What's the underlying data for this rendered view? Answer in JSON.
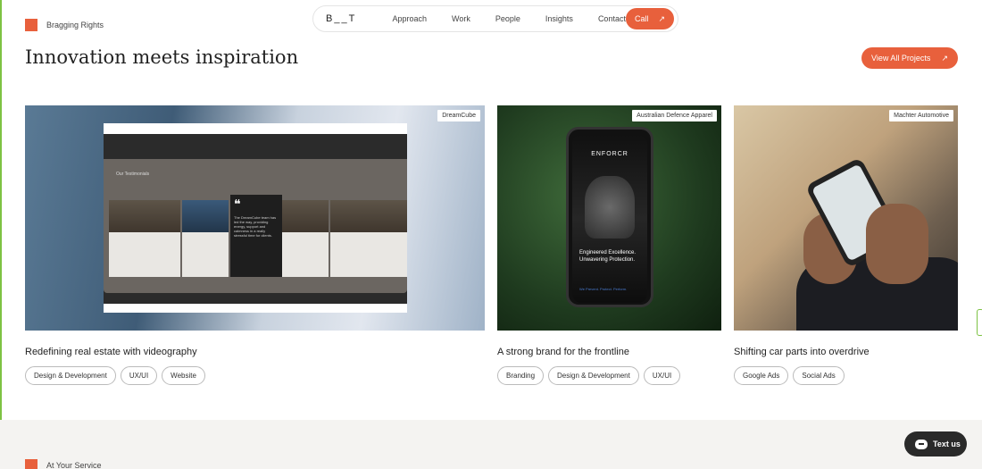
{
  "accent_color": "#e8603c",
  "nav": {
    "logo": "B__T",
    "links": [
      "Approach",
      "Work",
      "People",
      "Insights",
      "Contact"
    ],
    "call_label": "Call",
    "call_icon": "arrow-up-right-icon"
  },
  "section": {
    "tag": "Bragging Rights",
    "headline": "Innovation meets inspiration",
    "view_all_label": "View All Projects"
  },
  "projects": [
    {
      "client": "DreamCube",
      "title": "Redefining real estate with videography",
      "tags": [
        "Design & Development",
        "UX/UI",
        "Website"
      ],
      "mock_heading": "Our Testimonials",
      "mock_quote": "The DreamCube team has led the way, providing energy, support and calmness in a really stressful time for clients."
    },
    {
      "client": "Australian Defence Apparel",
      "title": "A strong brand for the frontline",
      "tags": [
        "Branding",
        "Design & Development",
        "UX/UI"
      ],
      "mock_brand": "ENFORCR",
      "mock_tagline": "Engineered Excellence. Unwavering Protection.",
      "mock_footer": "We Prevent. Protect. Perform."
    },
    {
      "client": "Machter Automotive",
      "title": "Shifting car parts into overdrive",
      "tags": [
        "Google Ads",
        "Social Ads"
      ]
    }
  ],
  "next_section": {
    "tag": "At Your Service"
  },
  "chat_widget": {
    "label": "Text us",
    "icon": "chat-bubble-icon"
  }
}
